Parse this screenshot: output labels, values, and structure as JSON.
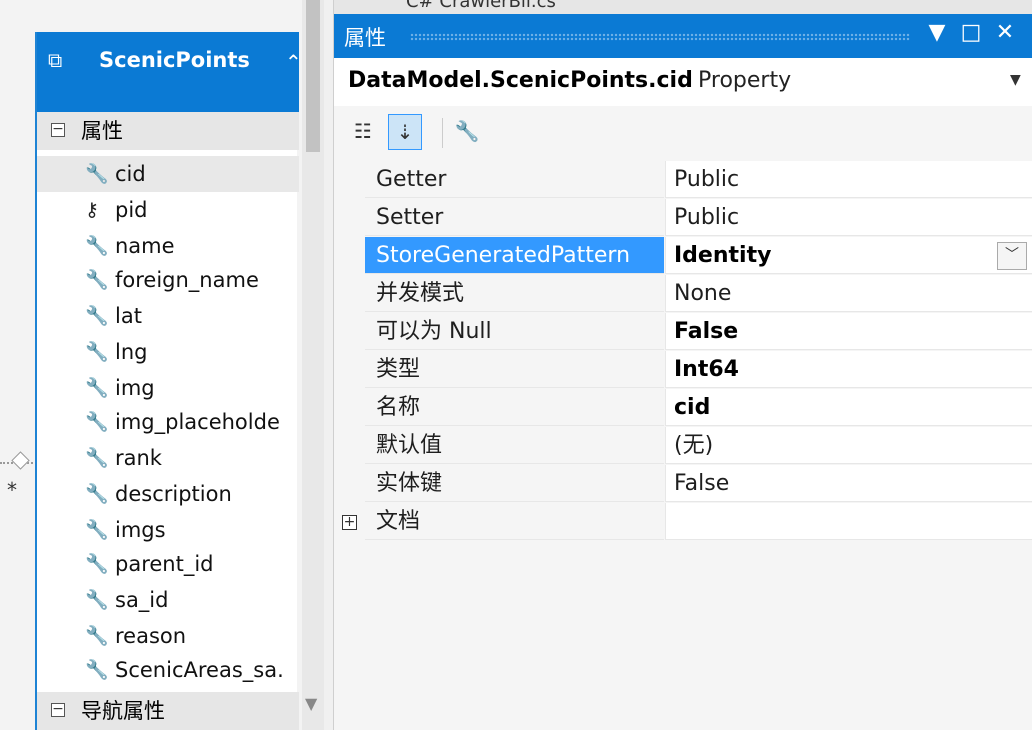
{
  "designer": {
    "entity": {
      "title": "ScenicPoints",
      "icon": "entity-icon",
      "sections": [
        {
          "label": "属性",
          "toggle": "−"
        },
        {
          "label": "导航属性",
          "toggle": "−"
        }
      ],
      "properties": [
        {
          "label": "cid",
          "icon": "key-wrench-icon"
        },
        {
          "label": "pid",
          "icon": "foreign-key-icon"
        },
        {
          "label": "name",
          "icon": "wrench-icon"
        },
        {
          "label": "foreign_name",
          "icon": "wrench-icon"
        },
        {
          "label": "lat",
          "icon": "wrench-icon"
        },
        {
          "label": "lng",
          "icon": "wrench-icon"
        },
        {
          "label": "img",
          "icon": "wrench-icon"
        },
        {
          "label": "img_placeholde",
          "icon": "wrench-icon"
        },
        {
          "label": "rank",
          "icon": "wrench-icon"
        },
        {
          "label": "description",
          "icon": "wrench-icon"
        },
        {
          "label": "imgs",
          "icon": "wrench-icon"
        },
        {
          "label": "parent_id",
          "icon": "wrench-icon"
        },
        {
          "label": "sa_id",
          "icon": "wrench-icon"
        },
        {
          "label": "reason",
          "icon": "wrench-icon"
        },
        {
          "label": "ScenicAreas_sa.",
          "icon": "wrench-icon"
        }
      ]
    },
    "connector_multiplicity": "*"
  },
  "properties_panel": {
    "tab_text": "C# CrawlerBll.cs",
    "title": "属性",
    "title_buttons": {
      "dropdown": "▼",
      "maximize": "□",
      "close": "✕"
    },
    "object_name": "DataModel.ScenicPoints.cid",
    "object_kind": "Property",
    "toolbar": {
      "categorized": "categorized-icon",
      "alphabetical": "sort-az-icon",
      "property_pages": "wrench-icon"
    },
    "rows": [
      {
        "name": "Getter",
        "value": "Public",
        "bold": false
      },
      {
        "name": "Setter",
        "value": "Public",
        "bold": false
      },
      {
        "name": "StoreGeneratedPattern",
        "value": "Identity",
        "bold": true,
        "selected": true,
        "dropdown": true
      },
      {
        "name": "并发模式",
        "value": "None",
        "bold": false
      },
      {
        "name": "可以为 Null",
        "value": "False",
        "bold": true
      },
      {
        "name": "类型",
        "value": "Int64",
        "bold": true
      },
      {
        "name": "名称",
        "value": "cid",
        "bold": true
      },
      {
        "name": "默认值",
        "value": "(无)",
        "bold": false
      },
      {
        "name": "实体键",
        "value": "False",
        "bold": false
      },
      {
        "name": "文档",
        "value": "",
        "bold": false,
        "expander": "+"
      }
    ]
  },
  "colors": {
    "accent": "#0b7ad4",
    "selection": "#3399ff"
  }
}
